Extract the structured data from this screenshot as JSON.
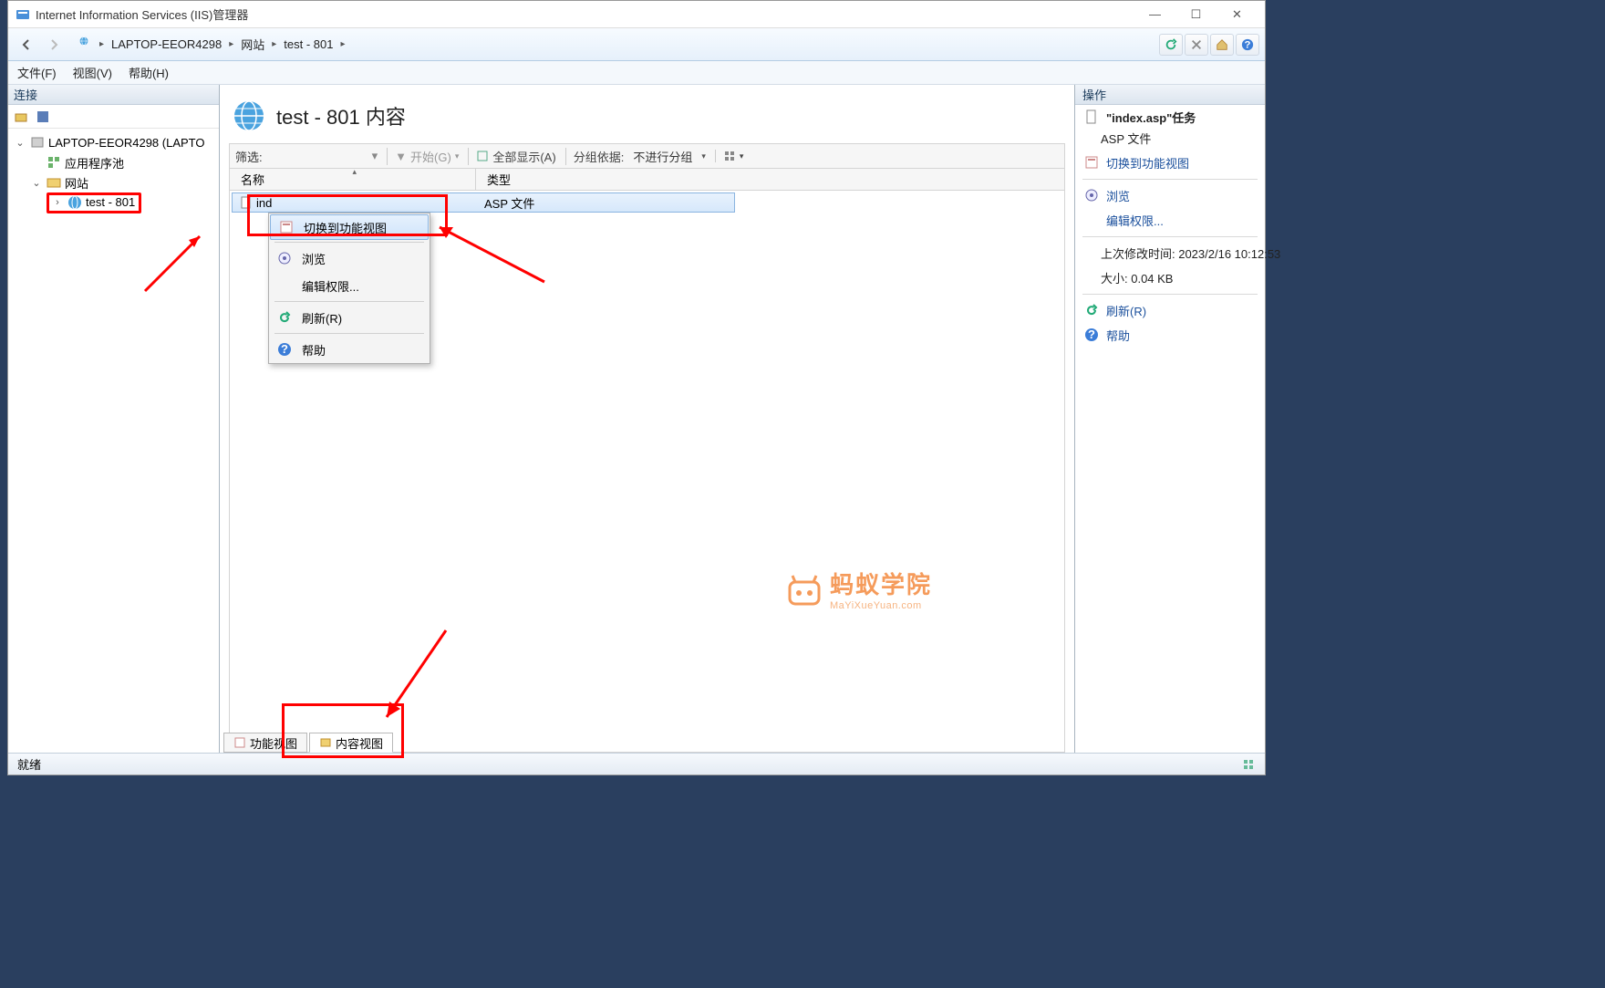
{
  "window": {
    "title": "Internet Information Services (IIS)管理器"
  },
  "breadcrumb": {
    "items": [
      "LAPTOP-EEOR4298",
      "网站",
      "test - 801"
    ]
  },
  "menubar": {
    "file": "文件(F)",
    "view": "视图(V)",
    "help": "帮助(H)"
  },
  "left": {
    "header": "连接",
    "tree": {
      "root": "LAPTOP-EEOR4298 (LAPTO",
      "pool": "应用程序池",
      "sites": "网站",
      "site1": "test - 801"
    }
  },
  "center": {
    "title": "test - 801 内容",
    "filter_label": "筛选:",
    "filter_value": "",
    "start": "开始(G)",
    "showall": "全部显示(A)",
    "groupby_label": "分组依据:",
    "groupby_value": "不进行分组",
    "col_name": "名称",
    "col_type": "类型",
    "row": {
      "name": "index.asp",
      "type": "ASP 文件",
      "name_partial": "ind"
    },
    "tabs": {
      "feature": "功能视图",
      "content": "内容视图"
    }
  },
  "context_menu": {
    "switch_view": "切换到功能视图",
    "browse": "浏览",
    "edit_perm": "编辑权限...",
    "refresh": "刷新(R)",
    "help": "帮助"
  },
  "right": {
    "header": "操作",
    "task_title": "\"index.asp\"任务",
    "task_type": "ASP 文件",
    "switch_view": "切换到功能视图",
    "browse": "浏览",
    "edit_perm": "编辑权限...",
    "modified_label": "上次修改时间: 2023/2/16 10:12:53",
    "size_label": "大小: 0.04 KB",
    "refresh": "刷新(R)",
    "help": "帮助"
  },
  "statusbar": {
    "ready": "就绪"
  },
  "watermark": {
    "main": "蚂蚁学院",
    "sub": "MaYiXueYuan.com"
  }
}
